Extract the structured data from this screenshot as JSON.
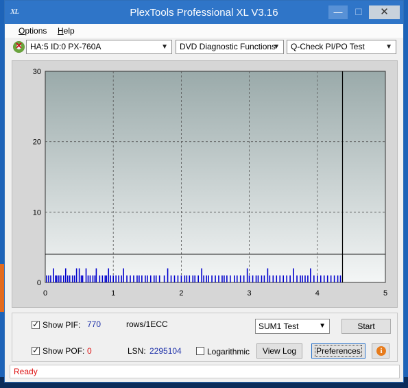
{
  "window": {
    "title": "PlexTools Professional XL V3.16",
    "icon_text": "XL"
  },
  "menu": [
    {
      "label": "Options",
      "accel": "O",
      "rest": "ptions"
    },
    {
      "label": "Help",
      "accel": "H",
      "rest": "elp"
    }
  ],
  "toolbar": {
    "drive": "HA:5 ID:0  PX-760A",
    "function": "DVD Diagnostic Functions",
    "test": "Q-Check PI/PO Test"
  },
  "chart_data": {
    "type": "bar",
    "xlim": [
      0,
      5
    ],
    "ylim": [
      0,
      30
    ],
    "x_ticks": [
      "0",
      "1",
      "2",
      "3",
      "4",
      "5"
    ],
    "y_ticks": [
      "0",
      "10",
      "20",
      "30"
    ],
    "grid": true,
    "threshold_line": 4,
    "end_marker": 4.37,
    "series": [
      {
        "color": "#0000cc",
        "x": [
          0.02,
          0.05,
          0.08,
          0.12,
          0.15,
          0.17,
          0.2,
          0.23,
          0.27,
          0.3,
          0.33,
          0.36,
          0.4,
          0.43,
          0.46,
          0.5,
          0.53,
          0.55,
          0.6,
          0.63,
          0.66,
          0.7,
          0.73,
          0.75,
          0.8,
          0.84,
          0.88,
          0.9,
          0.93,
          0.96,
          1.0,
          1.04,
          1.08,
          1.12,
          1.15,
          1.2,
          1.25,
          1.3,
          1.35,
          1.38,
          1.42,
          1.47,
          1.5,
          1.55,
          1.6,
          1.63,
          1.68,
          1.75,
          1.8,
          1.85,
          1.9,
          1.95,
          2.0,
          2.05,
          2.08,
          2.12,
          2.17,
          2.2,
          2.25,
          2.3,
          2.33,
          2.37,
          2.4,
          2.45,
          2.5,
          2.55,
          2.6,
          2.63,
          2.67,
          2.72,
          2.78,
          2.82,
          2.87,
          2.92,
          2.97,
          3.0,
          3.05,
          3.1,
          3.13,
          3.18,
          3.22,
          3.27,
          3.3,
          3.35,
          3.4,
          3.45,
          3.5,
          3.55,
          3.6,
          3.65,
          3.7,
          3.75,
          3.78,
          3.82,
          3.86,
          3.9,
          3.95,
          4.0,
          4.05,
          4.1,
          4.15,
          4.2,
          4.25,
          4.3,
          4.34
        ],
        "values": [
          1,
          1,
          1,
          2,
          1,
          1,
          1,
          1,
          1,
          2,
          1,
          1,
          1,
          1,
          2,
          2,
          1,
          1,
          2,
          1,
          1,
          1,
          1,
          2,
          1,
          1,
          1,
          1,
          2,
          1,
          1,
          1,
          1,
          1,
          2,
          1,
          1,
          1,
          1,
          1,
          1,
          1,
          1,
          1,
          1,
          1,
          1,
          1,
          2,
          1,
          1,
          1,
          1,
          1,
          1,
          1,
          1,
          1,
          1,
          2,
          1,
          1,
          1,
          1,
          1,
          1,
          1,
          1,
          1,
          1,
          1,
          1,
          1,
          1,
          2,
          1,
          1,
          1,
          1,
          1,
          1,
          2,
          1,
          1,
          1,
          1,
          1,
          1,
          1,
          2,
          1,
          1,
          1,
          1,
          1,
          2,
          1,
          1,
          1,
          1,
          1,
          1,
          1,
          1,
          1
        ]
      }
    ]
  },
  "controls": {
    "show_pif_label": "Show PIF:",
    "pif_value": "770",
    "rows_label": "rows/1ECC",
    "show_pof_label": "Show POF:",
    "pof_value": "0",
    "lsn_label": "LSN:",
    "lsn_value": "2295104",
    "logarithmic_label": "Logarithmic",
    "sum_select": "SUM1 Test",
    "start_button": "Start",
    "viewlog_button": "View Log",
    "preferences_button": "Preferences",
    "info_icon_text": "i"
  },
  "status": {
    "text": "Ready"
  }
}
